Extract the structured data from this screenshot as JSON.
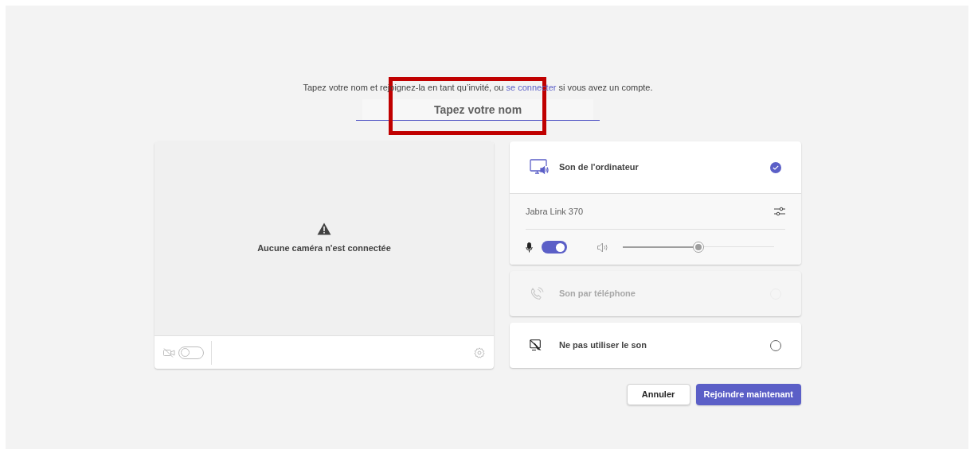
{
  "intro": {
    "before": "Tapez votre nom et rejoignez-la en tant qu’invité, ou ",
    "link": "se connecter",
    "after": " si vous avez un compte."
  },
  "name_field": {
    "placeholder": "Tapez votre nom"
  },
  "camera": {
    "message": "Aucune caméra n'est connectée",
    "on": false
  },
  "audio_options": [
    {
      "kind": "computer",
      "label": "Son de l'ordinateur",
      "selected": true,
      "disabled": false,
      "device": {
        "name": "Jabra Link 370",
        "mic_on": true,
        "level": 0.5
      }
    },
    {
      "kind": "phone",
      "label": "Son par téléphone",
      "selected": false,
      "disabled": true
    },
    {
      "kind": "none",
      "label": "Ne pas utiliser le son",
      "selected": false,
      "disabled": false
    }
  ],
  "buttons": [
    {
      "label": "Annuler",
      "kind": "secondary"
    },
    {
      "label": "Rejoindre maintenant",
      "kind": "primary"
    }
  ],
  "highlight": {
    "kind": "frame"
  }
}
